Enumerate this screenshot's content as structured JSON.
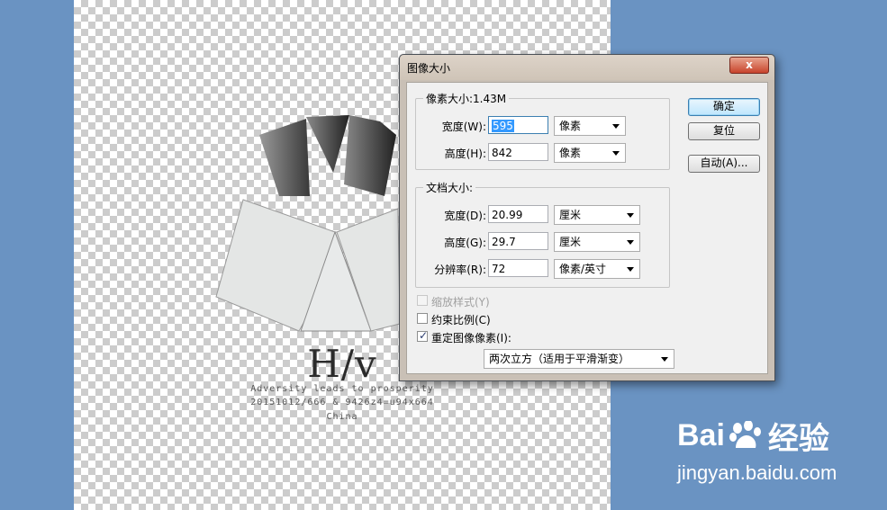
{
  "poster": {
    "title": "H/v",
    "line1": "Adversity leads to prosperity",
    "line2": "20151012/666 & 9426z4=u94x664",
    "line3": "China"
  },
  "watermark": {
    "brand": "Bai",
    "brand_suffix": "经验",
    "url": "jingyan.baidu.com"
  },
  "dialog": {
    "title": "图像大小",
    "close_label": "x",
    "pixel_size": {
      "legend": "像素大小:1.43M",
      "width_label": "宽度(W):",
      "width_value": "595",
      "width_unit": "像素",
      "height_label": "高度(H):",
      "height_value": "842",
      "height_unit": "像素"
    },
    "doc_size": {
      "legend": "文档大小:",
      "width_label": "宽度(D):",
      "width_value": "20.99",
      "width_unit": "厘米",
      "height_label": "高度(G):",
      "height_value": "29.7",
      "height_unit": "厘米",
      "res_label": "分辨率(R):",
      "res_value": "72",
      "res_unit": "像素/英寸"
    },
    "buttons": {
      "ok": "确定",
      "reset": "复位",
      "auto": "自动(A)..."
    },
    "options": {
      "scale_styles": "缩放样式(Y)",
      "constrain": "约束比例(C)",
      "resample": "重定图像像素(I):",
      "resample_method": "两次立方（适用于平滑渐变）"
    }
  }
}
